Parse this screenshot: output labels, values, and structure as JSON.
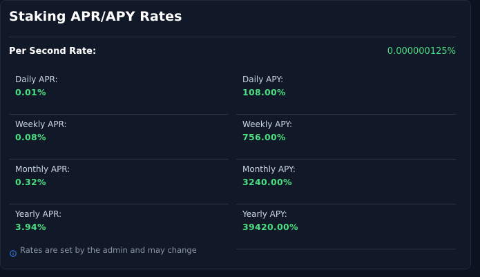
{
  "panel": {
    "title": "Staking APR/APY Rates"
  },
  "per_second": {
    "label": "Per Second Rate:",
    "value": "0.000000125%"
  },
  "rates": {
    "apr": [
      {
        "label": "Daily APR:",
        "value": "0.01%"
      },
      {
        "label": "Weekly APR:",
        "value": "0.08%"
      },
      {
        "label": "Monthly APR:",
        "value": "0.32%"
      },
      {
        "label": "Yearly APR:",
        "value": "3.94%"
      }
    ],
    "apy": [
      {
        "label": "Daily APY:",
        "value": "108.00%"
      },
      {
        "label": "Weekly APY:",
        "value": "756.00%"
      },
      {
        "label": "Monthly APY:",
        "value": "3240.00%"
      },
      {
        "label": "Yearly APY:",
        "value": "39420.00%"
      }
    ]
  },
  "footer": {
    "note": "Rates are set by the admin and may change",
    "icon": "info-icon"
  },
  "colors": {
    "background": "#111827",
    "accent": "#4ade80",
    "muted": "#8b95a5",
    "divider": "#2a3441",
    "info": "#3b82f6"
  }
}
